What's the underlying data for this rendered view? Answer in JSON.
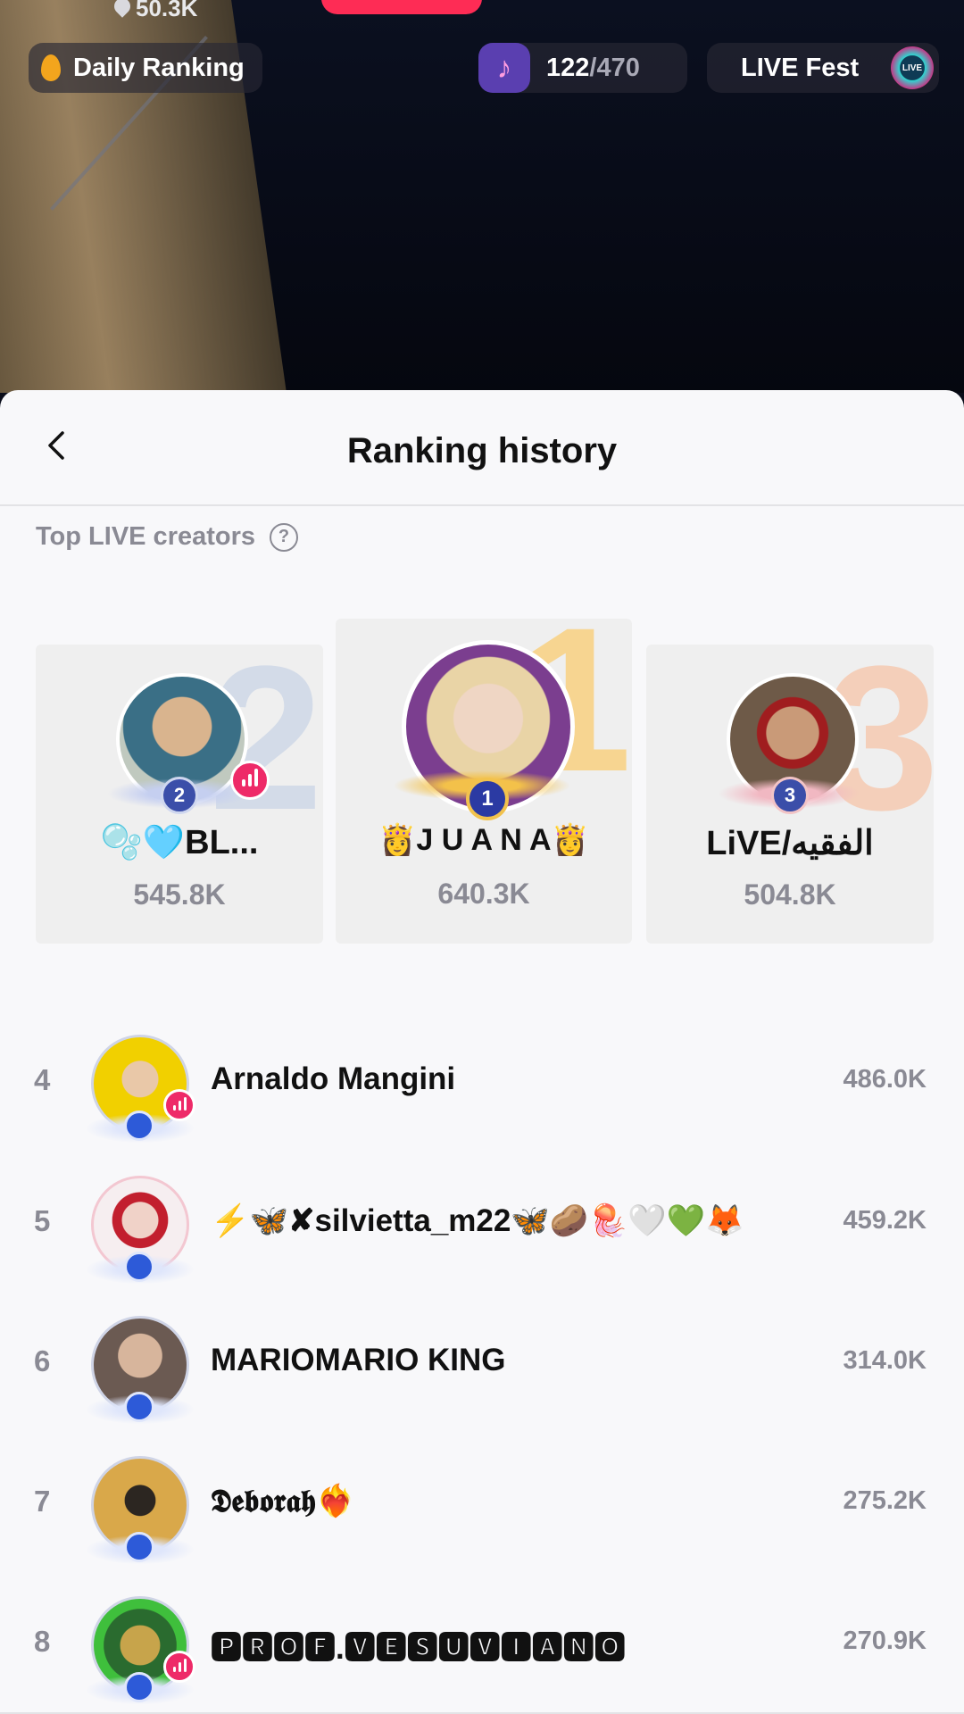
{
  "top_bar": {
    "likes": "50.3K",
    "daily_ranking": "Daily Ranking",
    "progress_current": "122",
    "progress_total": "/470",
    "live_fest": "LIVE Fest",
    "live_fest_badge": "LIVE"
  },
  "sheet": {
    "title": "Ranking history",
    "section_label": "Top LIVE creators",
    "help_symbol": "?"
  },
  "podium": [
    {
      "rank": "2",
      "name": "🫧🩵BL...",
      "score": "545.8K"
    },
    {
      "rank": "1",
      "name": "👸J U A N A👸",
      "score": "640.3K"
    },
    {
      "rank": "3",
      "name": "LiVE/الفقيه",
      "score": "504.8K"
    }
  ],
  "list": [
    {
      "rank": "4",
      "name": "Arnaldo Mangini",
      "score": "486.0K"
    },
    {
      "rank": "5",
      "name": "⚡🦋✘silvietta_m22🦋🥔🪼🤍💚🦊",
      "score": "459.2K"
    },
    {
      "rank": "6",
      "name": "MARIOMARIO KING",
      "score": "314.0K"
    },
    {
      "rank": "7",
      "name": "𝕯𝖊𝖇𝖔𝖗𝖆𝖍❤️‍🔥",
      "score": "275.2K"
    },
    {
      "rank": "8",
      "name": "🅿🆁🅾🅵.🆅🅴🆂🆄🆅🅸🅰🅽🅾",
      "score": "270.9K"
    }
  ],
  "colors": {
    "accent": "#fe2c55",
    "live_badge": "#ee2a68",
    "gold": "#f7d591",
    "muted_text": "#8a8a94"
  },
  "icons": [
    "heart-icon",
    "flame-icon",
    "music-note-icon",
    "back-chevron-icon",
    "help-circle-icon",
    "live-signal-icon"
  ]
}
